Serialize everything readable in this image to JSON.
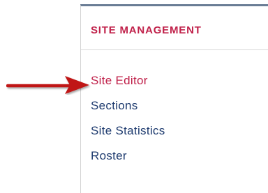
{
  "section": {
    "title": "SITE MANAGEMENT"
  },
  "nav": {
    "items": [
      {
        "label": "Site Editor",
        "active": true
      },
      {
        "label": "Sections",
        "active": false
      },
      {
        "label": "Site Statistics",
        "active": false
      },
      {
        "label": "Roster",
        "active": false
      }
    ]
  },
  "annotation": {
    "arrow_color": "#c01818",
    "points_to": "Site Editor"
  },
  "colors": {
    "accent": "#c0214a",
    "link": "#1d3a6e",
    "panel_border_top": "#6a7d95"
  }
}
